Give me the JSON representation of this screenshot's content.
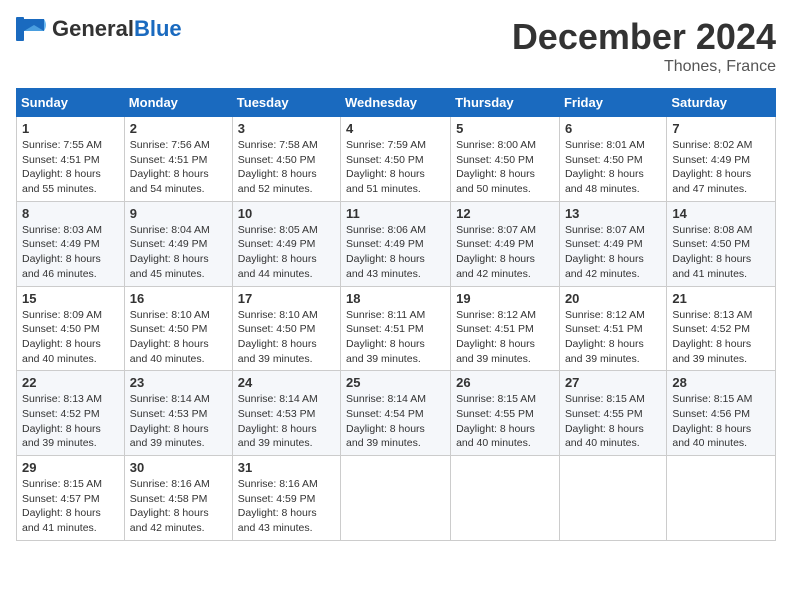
{
  "header": {
    "logo_general": "General",
    "logo_blue": "Blue",
    "month_title": "December 2024",
    "location": "Thones, France"
  },
  "weekdays": [
    "Sunday",
    "Monday",
    "Tuesday",
    "Wednesday",
    "Thursday",
    "Friday",
    "Saturday"
  ],
  "weeks": [
    [
      {
        "day": "1",
        "sunrise": "7:55 AM",
        "sunset": "4:51 PM",
        "daylight": "8 hours and 55 minutes."
      },
      {
        "day": "2",
        "sunrise": "7:56 AM",
        "sunset": "4:51 PM",
        "daylight": "8 hours and 54 minutes."
      },
      {
        "day": "3",
        "sunrise": "7:58 AM",
        "sunset": "4:50 PM",
        "daylight": "8 hours and 52 minutes."
      },
      {
        "day": "4",
        "sunrise": "7:59 AM",
        "sunset": "4:50 PM",
        "daylight": "8 hours and 51 minutes."
      },
      {
        "day": "5",
        "sunrise": "8:00 AM",
        "sunset": "4:50 PM",
        "daylight": "8 hours and 50 minutes."
      },
      {
        "day": "6",
        "sunrise": "8:01 AM",
        "sunset": "4:50 PM",
        "daylight": "8 hours and 48 minutes."
      },
      {
        "day": "7",
        "sunrise": "8:02 AM",
        "sunset": "4:49 PM",
        "daylight": "8 hours and 47 minutes."
      }
    ],
    [
      {
        "day": "8",
        "sunrise": "8:03 AM",
        "sunset": "4:49 PM",
        "daylight": "8 hours and 46 minutes."
      },
      {
        "day": "9",
        "sunrise": "8:04 AM",
        "sunset": "4:49 PM",
        "daylight": "8 hours and 45 minutes."
      },
      {
        "day": "10",
        "sunrise": "8:05 AM",
        "sunset": "4:49 PM",
        "daylight": "8 hours and 44 minutes."
      },
      {
        "day": "11",
        "sunrise": "8:06 AM",
        "sunset": "4:49 PM",
        "daylight": "8 hours and 43 minutes."
      },
      {
        "day": "12",
        "sunrise": "8:07 AM",
        "sunset": "4:49 PM",
        "daylight": "8 hours and 42 minutes."
      },
      {
        "day": "13",
        "sunrise": "8:07 AM",
        "sunset": "4:49 PM",
        "daylight": "8 hours and 42 minutes."
      },
      {
        "day": "14",
        "sunrise": "8:08 AM",
        "sunset": "4:50 PM",
        "daylight": "8 hours and 41 minutes."
      }
    ],
    [
      {
        "day": "15",
        "sunrise": "8:09 AM",
        "sunset": "4:50 PM",
        "daylight": "8 hours and 40 minutes."
      },
      {
        "day": "16",
        "sunrise": "8:10 AM",
        "sunset": "4:50 PM",
        "daylight": "8 hours and 40 minutes."
      },
      {
        "day": "17",
        "sunrise": "8:10 AM",
        "sunset": "4:50 PM",
        "daylight": "8 hours and 39 minutes."
      },
      {
        "day": "18",
        "sunrise": "8:11 AM",
        "sunset": "4:51 PM",
        "daylight": "8 hours and 39 minutes."
      },
      {
        "day": "19",
        "sunrise": "8:12 AM",
        "sunset": "4:51 PM",
        "daylight": "8 hours and 39 minutes."
      },
      {
        "day": "20",
        "sunrise": "8:12 AM",
        "sunset": "4:51 PM",
        "daylight": "8 hours and 39 minutes."
      },
      {
        "day": "21",
        "sunrise": "8:13 AM",
        "sunset": "4:52 PM",
        "daylight": "8 hours and 39 minutes."
      }
    ],
    [
      {
        "day": "22",
        "sunrise": "8:13 AM",
        "sunset": "4:52 PM",
        "daylight": "8 hours and 39 minutes."
      },
      {
        "day": "23",
        "sunrise": "8:14 AM",
        "sunset": "4:53 PM",
        "daylight": "8 hours and 39 minutes."
      },
      {
        "day": "24",
        "sunrise": "8:14 AM",
        "sunset": "4:53 PM",
        "daylight": "8 hours and 39 minutes."
      },
      {
        "day": "25",
        "sunrise": "8:14 AM",
        "sunset": "4:54 PM",
        "daylight": "8 hours and 39 minutes."
      },
      {
        "day": "26",
        "sunrise": "8:15 AM",
        "sunset": "4:55 PM",
        "daylight": "8 hours and 40 minutes."
      },
      {
        "day": "27",
        "sunrise": "8:15 AM",
        "sunset": "4:55 PM",
        "daylight": "8 hours and 40 minutes."
      },
      {
        "day": "28",
        "sunrise": "8:15 AM",
        "sunset": "4:56 PM",
        "daylight": "8 hours and 40 minutes."
      }
    ],
    [
      {
        "day": "29",
        "sunrise": "8:15 AM",
        "sunset": "4:57 PM",
        "daylight": "8 hours and 41 minutes."
      },
      {
        "day": "30",
        "sunrise": "8:16 AM",
        "sunset": "4:58 PM",
        "daylight": "8 hours and 42 minutes."
      },
      {
        "day": "31",
        "sunrise": "8:16 AM",
        "sunset": "4:59 PM",
        "daylight": "8 hours and 43 minutes."
      },
      null,
      null,
      null,
      null
    ]
  ],
  "labels": {
    "sunrise": "Sunrise:",
    "sunset": "Sunset:",
    "daylight": "Daylight:"
  }
}
